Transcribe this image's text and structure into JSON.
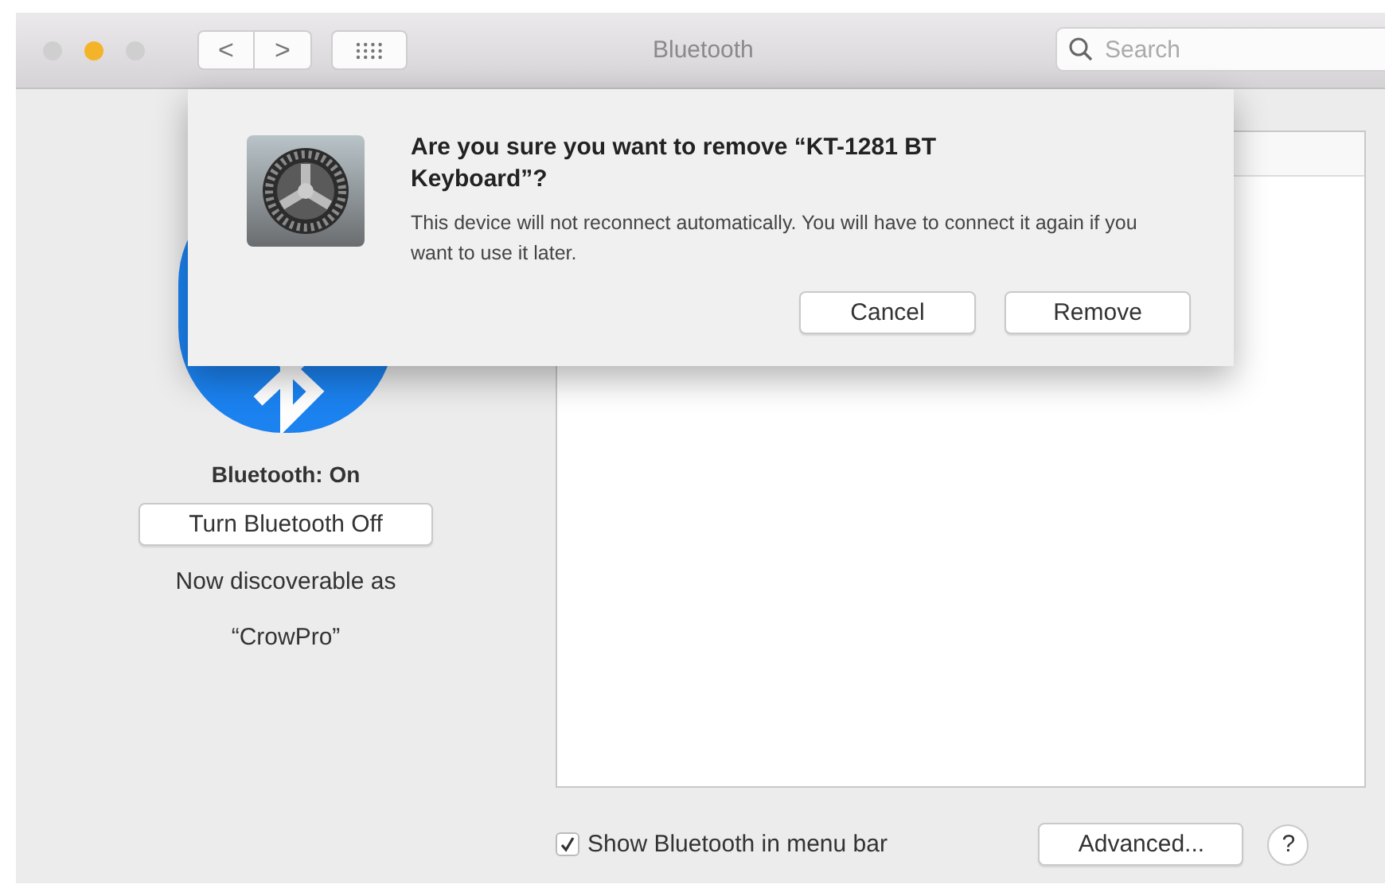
{
  "window": {
    "title": "Bluetooth",
    "traffic_lights": [
      {
        "color": "#d0cfd0"
      },
      {
        "color": "#f4b42a"
      },
      {
        "color": "#d0cfd0"
      }
    ]
  },
  "toolbar": {
    "back": "<",
    "forward": ">",
    "search": {
      "placeholder": "Search"
    }
  },
  "status": {
    "label": "Bluetooth: On",
    "toggle_button": "Turn Bluetooth Off",
    "discoverable_label": "Now discoverable as",
    "device_name": "“CrowPro”"
  },
  "options": {
    "show_in_menu_bar": {
      "label": "Show Bluetooth in menu bar",
      "checked": true
    },
    "advanced_button": "Advanced...",
    "help_button": "?"
  },
  "dialog": {
    "title": "Are you sure you want to remove “KT-1281 BT Keyboard”?",
    "message": "This device will not reconnect automatically. You will have to connect it again if you want to use it later.",
    "buttons": [
      "Cancel",
      "Remove"
    ]
  }
}
